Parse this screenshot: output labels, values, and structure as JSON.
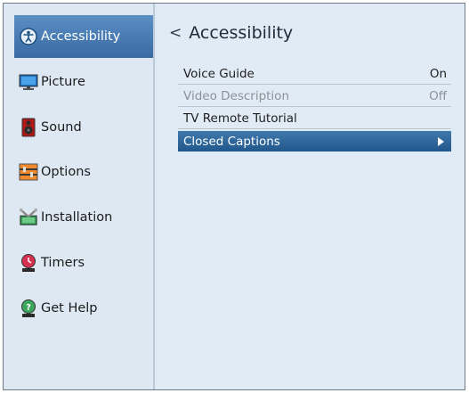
{
  "sidebar": {
    "items": [
      {
        "label": "Accessibility",
        "icon": "accessibility-icon",
        "active": true
      },
      {
        "label": "Picture",
        "icon": "picture-icon"
      },
      {
        "label": "Sound",
        "icon": "speaker-icon"
      },
      {
        "label": "Options",
        "icon": "options-icon"
      },
      {
        "label": "Installation",
        "icon": "installation-icon"
      },
      {
        "label": "Timers",
        "icon": "timer-icon"
      },
      {
        "label": "Get Help",
        "icon": "help-icon"
      }
    ]
  },
  "main": {
    "back_glyph": "<",
    "title": "Accessibility",
    "rows": [
      {
        "label": "Voice Guide",
        "value": "On"
      },
      {
        "label": "Video Description",
        "value": "Off",
        "disabled": true
      },
      {
        "label": "TV Remote Tutorial",
        "value": ""
      },
      {
        "label": "Closed Captions",
        "value": "",
        "selected": true
      }
    ]
  },
  "colors": {
    "selection": "#3a6aa4",
    "panel": "#dde8f3",
    "disabled_text": "#8d9298"
  }
}
